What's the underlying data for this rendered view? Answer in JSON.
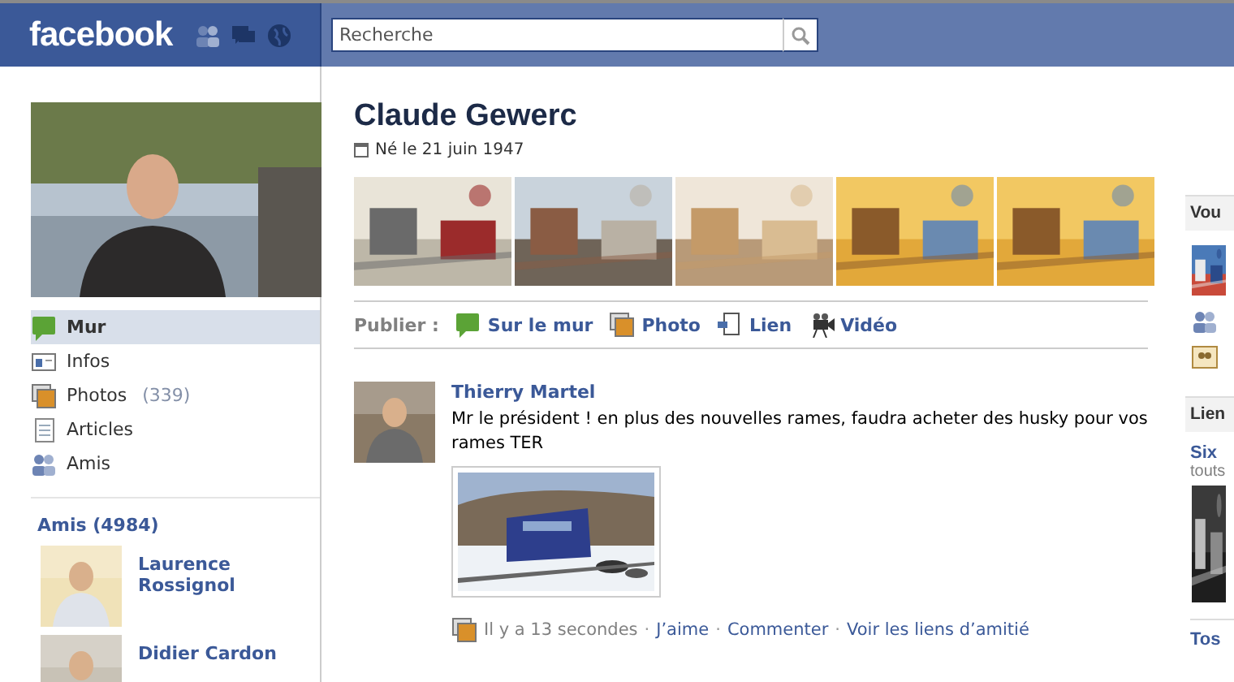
{
  "topbar": {
    "logo": "facebook",
    "search": {
      "placeholder": "Recherche"
    }
  },
  "profile": {
    "name": "Claude Gewerc",
    "birth": "Né le 21 juin 1947"
  },
  "sidebar": {
    "items": [
      {
        "kind": "wall",
        "label": "Mur",
        "selected": true
      },
      {
        "kind": "info",
        "label": "Infos",
        "selected": false
      },
      {
        "kind": "photos",
        "label": "Photos",
        "count": "(339)",
        "selected": false
      },
      {
        "kind": "notes",
        "label": "Articles",
        "selected": false
      },
      {
        "kind": "friends",
        "label": "Amis",
        "selected": false
      }
    ],
    "friends_heading": "Amis (4984)",
    "friends": [
      {
        "name": "Laurence Rossignol"
      },
      {
        "name": "Didier Cardon"
      }
    ]
  },
  "publish": {
    "label": "Publier :",
    "actions": [
      {
        "kind": "wall",
        "label": "Sur le mur"
      },
      {
        "label": "Photo"
      },
      {
        "kind": "link",
        "label": "Lien"
      },
      {
        "kind": "video",
        "label": "Vidéo"
      }
    ]
  },
  "post": {
    "author": "Thierry Martel",
    "text": "Mr le président ! en plus des nouvelles rames, faudra acheter des husky pour vos rames TER",
    "time": "Il y a 13 secondes",
    "separator": "·",
    "actions": [
      "J’aime",
      "Commenter",
      "Voir les liens d’amitié"
    ]
  },
  "right": {
    "box_1_title": "Vou",
    "box_2_title": "Lien",
    "link_title": "Six",
    "link_source": "touts",
    "next_title": "Tos"
  }
}
